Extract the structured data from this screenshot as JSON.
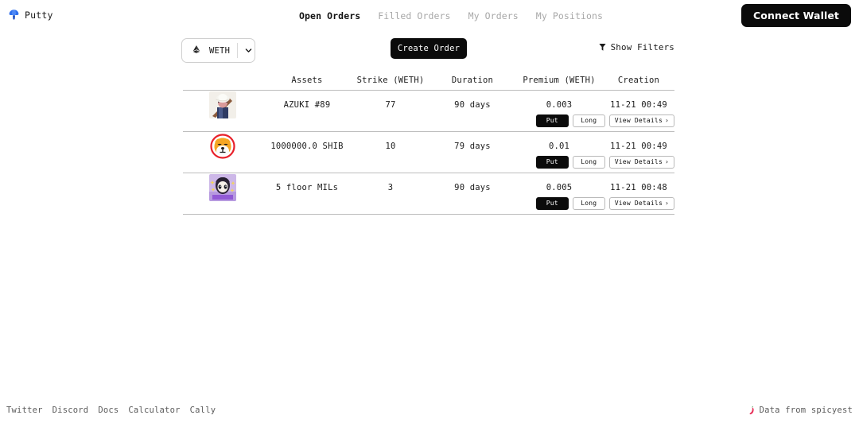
{
  "brand": {
    "name": "Putty",
    "logo_icon": "mushroom-icon",
    "logo_color": "#2563eb"
  },
  "nav": {
    "items": [
      {
        "label": "Open Orders",
        "active": true
      },
      {
        "label": "Filled Orders",
        "active": false
      },
      {
        "label": "My Orders",
        "active": false
      },
      {
        "label": "My Positions",
        "active": false
      }
    ]
  },
  "header": {
    "connect_wallet_label": "Connect Wallet",
    "connect_wallet_bg": "#0b0b0b"
  },
  "controls": {
    "token_selector": {
      "icon": "ethereum-icon",
      "value": "WETH",
      "chevron_icon": "chevron-down-icon"
    },
    "create_order_label": "Create Order",
    "show_filters": {
      "icon": "filter-funnel-icon",
      "label": "Show Filters"
    }
  },
  "table": {
    "columns": [
      "",
      "Assets",
      "Strike (WETH)",
      "Duration",
      "Premium (WETH)",
      "Creation"
    ],
    "row_actions": {
      "put_label": "Put",
      "long_label": "Long",
      "details_label": "View Details",
      "details_chevron": "›"
    },
    "rows": [
      {
        "avatar_name": "azuki-nft-avatar",
        "asset": "AZUKI #89",
        "strike": "77",
        "duration": "90 days",
        "premium": "0.003",
        "creation": "11-21 00:49"
      },
      {
        "avatar_name": "shib-token-avatar",
        "asset": "1000000.0 SHIB",
        "strike": "10",
        "duration": "79 days",
        "premium": "0.01",
        "creation": "11-21 00:49"
      },
      {
        "avatar_name": "mil-nft-avatar",
        "asset": "5 floor MILs",
        "strike": "3",
        "duration": "90 days",
        "premium": "0.005",
        "creation": "11-21 00:48"
      }
    ]
  },
  "footer": {
    "links": [
      "Twitter",
      "Discord",
      "Docs",
      "Calculator",
      "Cally"
    ],
    "credit": {
      "icon": "chili-pepper-icon",
      "label": "Data from spicyest",
      "icon_color": "#e8315a"
    }
  }
}
